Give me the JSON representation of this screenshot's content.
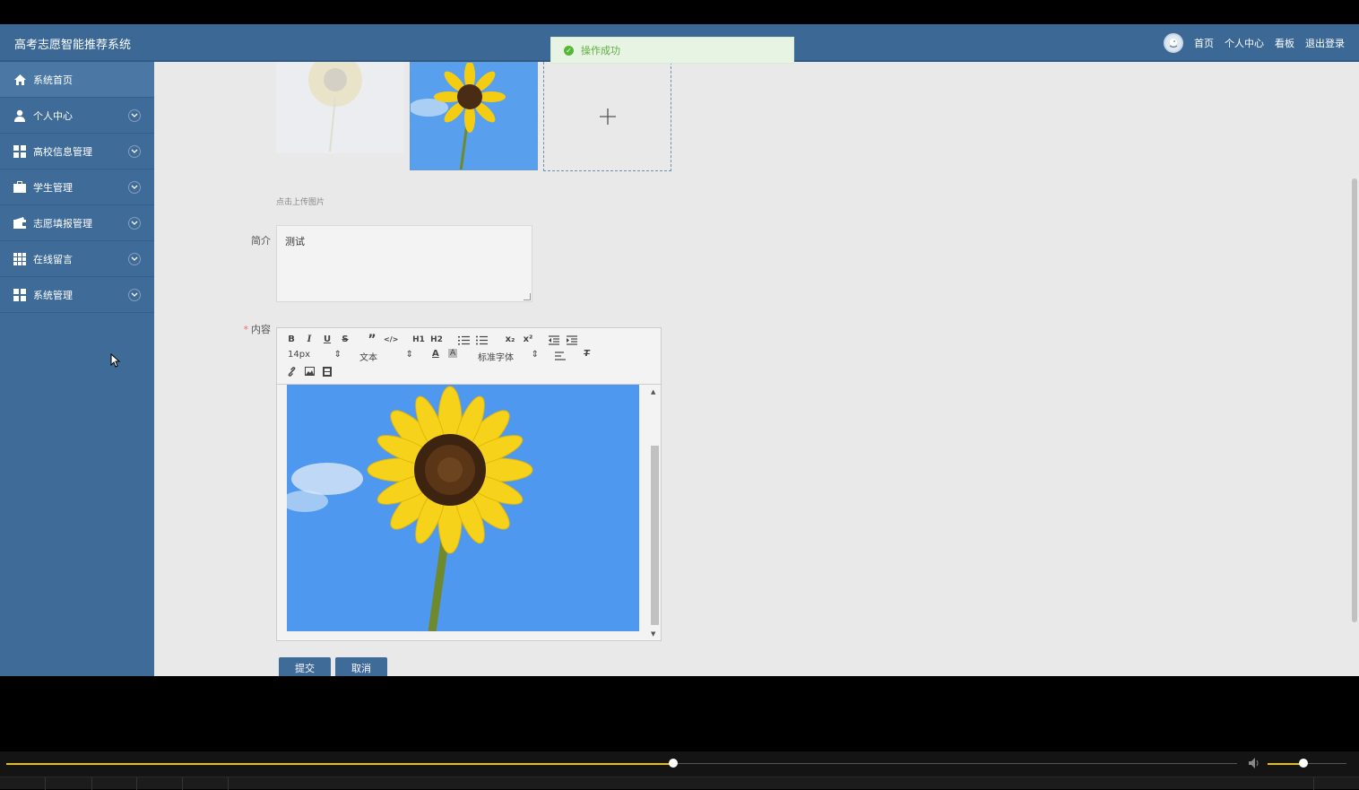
{
  "app": {
    "title": "高考志愿智能推荐系统"
  },
  "toast": {
    "message": "操作成功",
    "color": "#5daf3f"
  },
  "top_nav": {
    "links": [
      "首页",
      "个人中心",
      "看板",
      "退出登录"
    ]
  },
  "sidebar": {
    "items": [
      {
        "label": "系统首页",
        "icon": "home-icon"
      },
      {
        "label": "个人中心",
        "icon": "user-icon"
      },
      {
        "label": "高校信息管理",
        "icon": "grid-icon"
      },
      {
        "label": "学生管理",
        "icon": "briefcase-icon"
      },
      {
        "label": "志愿填报管理",
        "icon": "wallet-icon"
      },
      {
        "label": "在线留言",
        "icon": "apps-icon"
      },
      {
        "label": "系统管理",
        "icon": "grid-icon"
      }
    ]
  },
  "form": {
    "upload_hint": "点击上传图片",
    "intro_label": "简介",
    "intro_value": "测试",
    "content_label": "内容",
    "required_mark": "*",
    "submit_label": "提交",
    "cancel_label": "取消"
  },
  "editor": {
    "buttons": [
      "B",
      "I",
      "U",
      "S",
      "”",
      "</>",
      "H1",
      "H2"
    ],
    "subscript": "x₂",
    "superscript": "x²",
    "size_value": "14px",
    "format_value": "文本",
    "font_value": "标准字体"
  },
  "colors": {
    "primary": "#3e6b98",
    "topbar": "#3b6895",
    "player_progress": "#e5c100"
  },
  "player": {
    "progress": 0.542,
    "volume": 0.45
  }
}
